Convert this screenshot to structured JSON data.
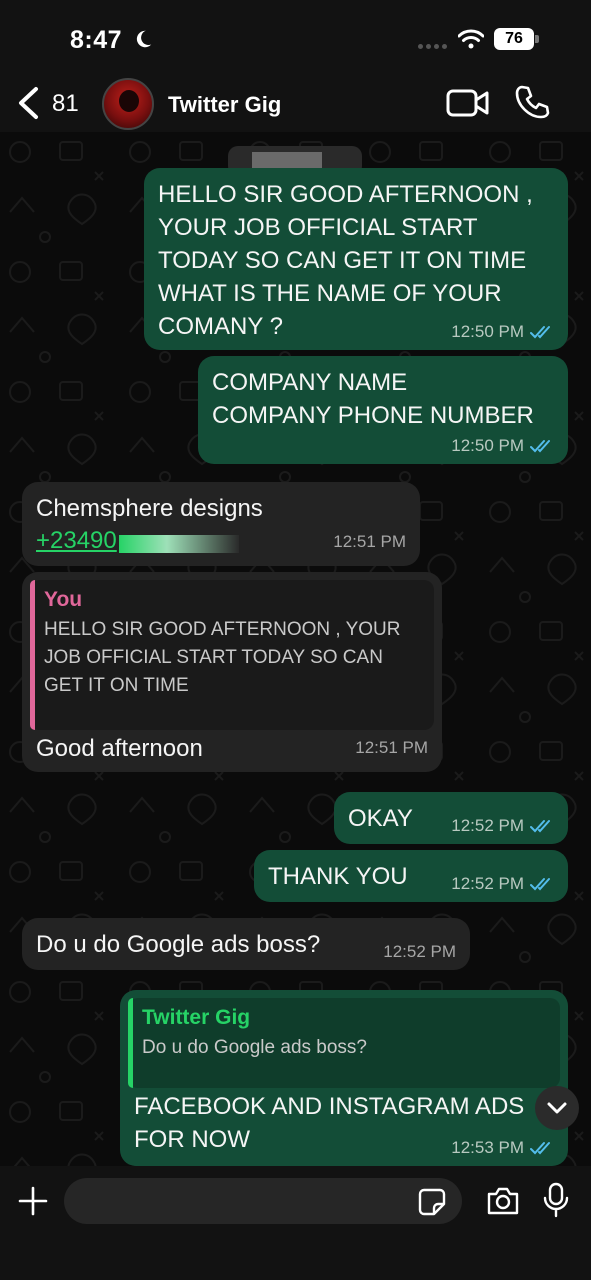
{
  "status_bar": {
    "time": "8:47",
    "battery": "76"
  },
  "header": {
    "back_count": "81",
    "contact_name": "Twitter Gig"
  },
  "messages": [
    {
      "direction": "out",
      "text": "HELLO SIR GOOD AFTERNOON ,\nYOUR JOB OFFICIAL START\nTODAY SO CAN GET IT ON TIME\nWHAT IS THE NAME OF YOUR\nCOMANY ?",
      "time": "12:50 PM"
    },
    {
      "direction": "out",
      "text": "COMPANY NAME\nCOMPANY PHONE NUMBER",
      "time": "12:50 PM"
    },
    {
      "direction": "in",
      "text": "Chemsphere designs",
      "link": "+23490",
      "time": "12:51 PM"
    },
    {
      "direction": "in",
      "quote_author": "You",
      "quote_text": "HELLO SIR GOOD AFTERNOON , YOUR JOB OFFICIAL START TODAY SO CAN GET IT ON TIME",
      "text": "Good afternoon",
      "time": "12:51 PM"
    },
    {
      "direction": "out",
      "text": "OKAY",
      "time": "12:52 PM"
    },
    {
      "direction": "out",
      "text": "THANK YOU",
      "time": "12:52 PM"
    },
    {
      "direction": "in",
      "text": "Do u do Google ads boss?",
      "time": "12:52 PM"
    },
    {
      "direction": "out",
      "quote_author": "Twitter Gig",
      "quote_text": "Do u do Google ads boss?",
      "text": "FACEBOOK AND INSTAGRAM ADS\nFOR NOW",
      "time": "12:53 PM"
    }
  ],
  "composer": {
    "placeholder": ""
  },
  "colors": {
    "outgoing_bubble": "#134d37",
    "incoming_bubble": "#232323",
    "accent_green": "#26d366",
    "read_ticks": "#53bdeb",
    "reply_pink": "#e0679a"
  },
  "icons": [
    "back-chevron-icon",
    "video-call-icon",
    "phone-icon",
    "double-check-icon",
    "chevron-down-icon",
    "plus-icon",
    "sticker-icon",
    "camera-icon",
    "microphone-icon"
  ]
}
